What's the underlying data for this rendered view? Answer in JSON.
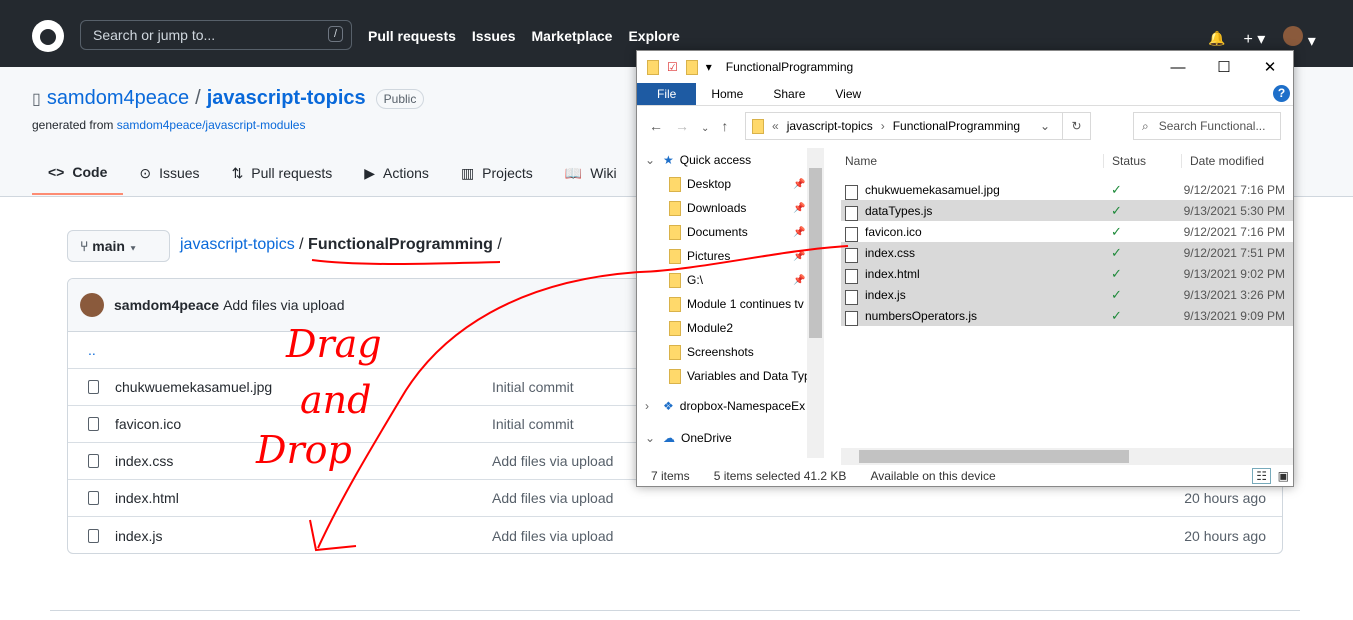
{
  "header": {
    "search_placeholder": "Search or jump to...",
    "slash": "/",
    "nav": [
      "Pull requests",
      "Issues",
      "Marketplace",
      "Explore"
    ],
    "bell": "🔔",
    "plus": "+ ▾",
    "avatar_caret": "▾"
  },
  "repo": {
    "owner": "samdom4peace",
    "sep": "/",
    "name": "javascript-topics",
    "visibility": "Public",
    "generated_prefix": "generated from ",
    "generated_link": "samdom4peace/javascript-modules",
    "tabs": [
      {
        "icon": "<>",
        "label": "Code"
      },
      {
        "icon": "⊙",
        "label": "Issues"
      },
      {
        "icon": "⇅",
        "label": "Pull requests"
      },
      {
        "icon": "▶",
        "label": "Actions"
      },
      {
        "icon": "▥",
        "label": "Projects"
      },
      {
        "icon": "📖",
        "label": "Wiki"
      }
    ]
  },
  "branch": {
    "label": "main",
    "caret": "▾"
  },
  "breadcrumb": {
    "root": "javascript-topics",
    "sep": " / ",
    "current": "FunctionalProgramming",
    "trail": " /"
  },
  "commit": {
    "author": "samdom4peace",
    "message": "Add files via upload"
  },
  "files": [
    {
      "name": "..",
      "message": "",
      "time": ""
    },
    {
      "name": "chukwuemekasamuel.jpg",
      "message": "Initial commit",
      "time": ""
    },
    {
      "name": "favicon.ico",
      "message": "Initial commit",
      "time": ""
    },
    {
      "name": "index.css",
      "message": "Add files via upload",
      "time": ""
    },
    {
      "name": "index.html",
      "message": "Add files via upload",
      "time": "20 hours ago"
    },
    {
      "name": "index.js",
      "message": "Add files via upload",
      "time": "20 hours ago"
    }
  ],
  "explorer": {
    "title": "FunctionalProgramming",
    "ribbon": [
      "File",
      "Home",
      "Share",
      "View"
    ],
    "help": "?",
    "address": {
      "prefix": "«",
      "parent": "javascript-topics",
      "chev": "›",
      "current": "FunctionalProgramming"
    },
    "search_placeholder": "Search Functional...",
    "nav": [
      {
        "label": "Quick access",
        "top": true,
        "pin": false
      },
      {
        "label": "Desktop",
        "pin": true
      },
      {
        "label": "Downloads",
        "pin": true
      },
      {
        "label": "Documents",
        "pin": true
      },
      {
        "label": "Pictures",
        "pin": true
      },
      {
        "label": "G:\\",
        "pin": true
      },
      {
        "label": "Module 1 continues tv",
        "pin": false
      },
      {
        "label": "Module2",
        "pin": false
      },
      {
        "label": "Screenshots",
        "pin": false
      },
      {
        "label": "Variables and Data Typ",
        "pin": false
      },
      {
        "label": "dropbox-NamespaceEx",
        "top": true,
        "pin": false
      },
      {
        "label": "OneDrive",
        "top": true,
        "pin": false
      }
    ],
    "columns": [
      "Name",
      "Status",
      "Date modified"
    ],
    "files": [
      {
        "name": "chukwuemekasamuel.jpg",
        "status": "✓",
        "date": "9/12/2021 7:16 PM",
        "selected": false
      },
      {
        "name": "dataTypes.js",
        "status": "✓",
        "date": "9/13/2021 5:30 PM",
        "selected": true
      },
      {
        "name": "favicon.ico",
        "status": "✓",
        "date": "9/12/2021 7:16 PM",
        "selected": false
      },
      {
        "name": "index.css",
        "status": "✓",
        "date": "9/12/2021 7:51 PM",
        "selected": true
      },
      {
        "name": "index.html",
        "status": "✓",
        "date": "9/13/2021 9:02 PM",
        "selected": true
      },
      {
        "name": "index.js",
        "status": "✓",
        "date": "9/13/2021 3:26 PM",
        "selected": true
      },
      {
        "name": "numbersOperators.js",
        "status": "✓",
        "date": "9/13/2021 9:09 PM",
        "selected": true
      }
    ],
    "status": {
      "items": "7 items",
      "selected": "5 items selected  41.2 KB",
      "availability": "Available on this device"
    }
  },
  "annotation": {
    "color": "#ff0000",
    "words": [
      "Drag",
      "and",
      "Drop"
    ]
  }
}
